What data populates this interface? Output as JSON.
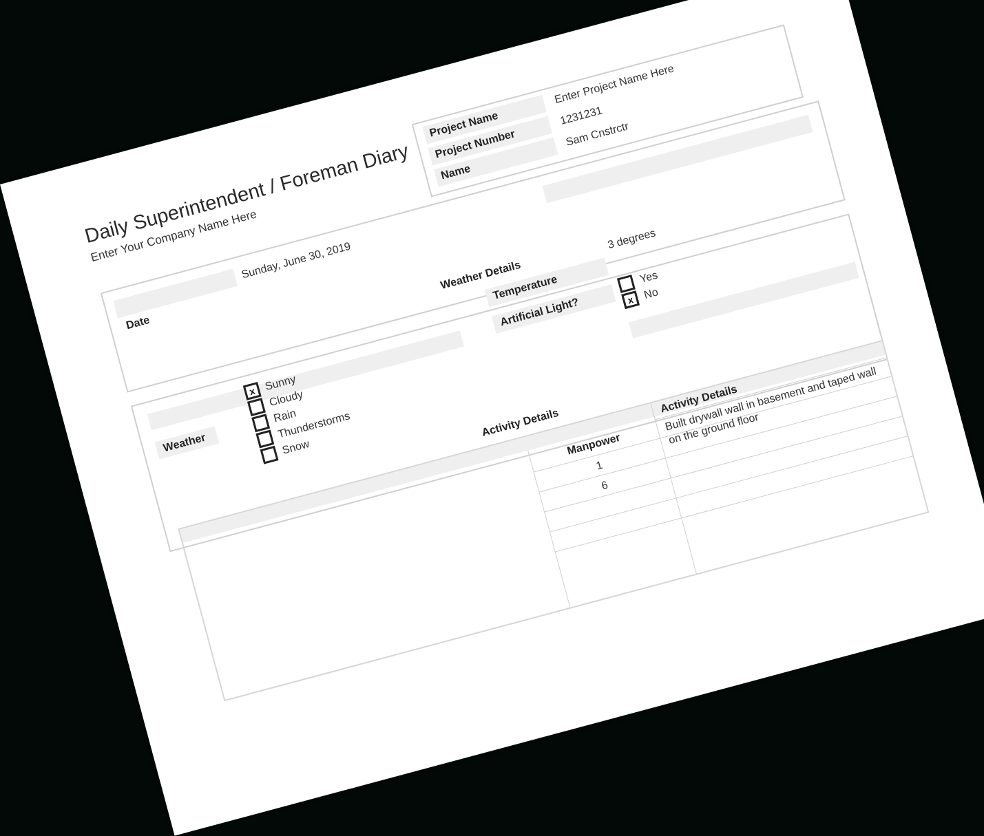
{
  "document": {
    "title": "Daily Superintendent / Foreman Diary",
    "company": "Enter Your Company Name Here"
  },
  "project": {
    "project_name_label": "Project Name",
    "project_name_value": "Enter Project Name Here",
    "project_number_label": "Project Number",
    "project_number_value": "1231231",
    "name_label": "Name",
    "name_value": "Sam Cnstrctr"
  },
  "date": {
    "label": "Date",
    "value": "Sunday, June 30, 2019"
  },
  "weather": {
    "section_title": "Weather Details",
    "weather_label": "Weather",
    "options": [
      {
        "label": "Sunny",
        "mark": "x"
      },
      {
        "label": "Cloudy",
        "mark": ""
      },
      {
        "label": "Rain",
        "mark": ""
      },
      {
        "label": "Thunderstorms",
        "mark": ""
      },
      {
        "label": "Snow",
        "mark": ""
      }
    ],
    "temperature_label": "Temperature",
    "temperature_value": "3 degrees",
    "artificial_light_label": "Artificial Light?",
    "artificial_light_options": [
      {
        "label": "Yes",
        "mark": ""
      },
      {
        "label": "No",
        "mark": "x"
      }
    ]
  },
  "activity": {
    "section_title": "Activity Details",
    "col_manpower": "Manpower",
    "col_details": "Activity Details",
    "rows": [
      {
        "manpower": "1",
        "details": "Built drywall wall in basement and taped wall on the ground floor"
      },
      {
        "manpower": "6",
        "details": ""
      }
    ]
  }
}
